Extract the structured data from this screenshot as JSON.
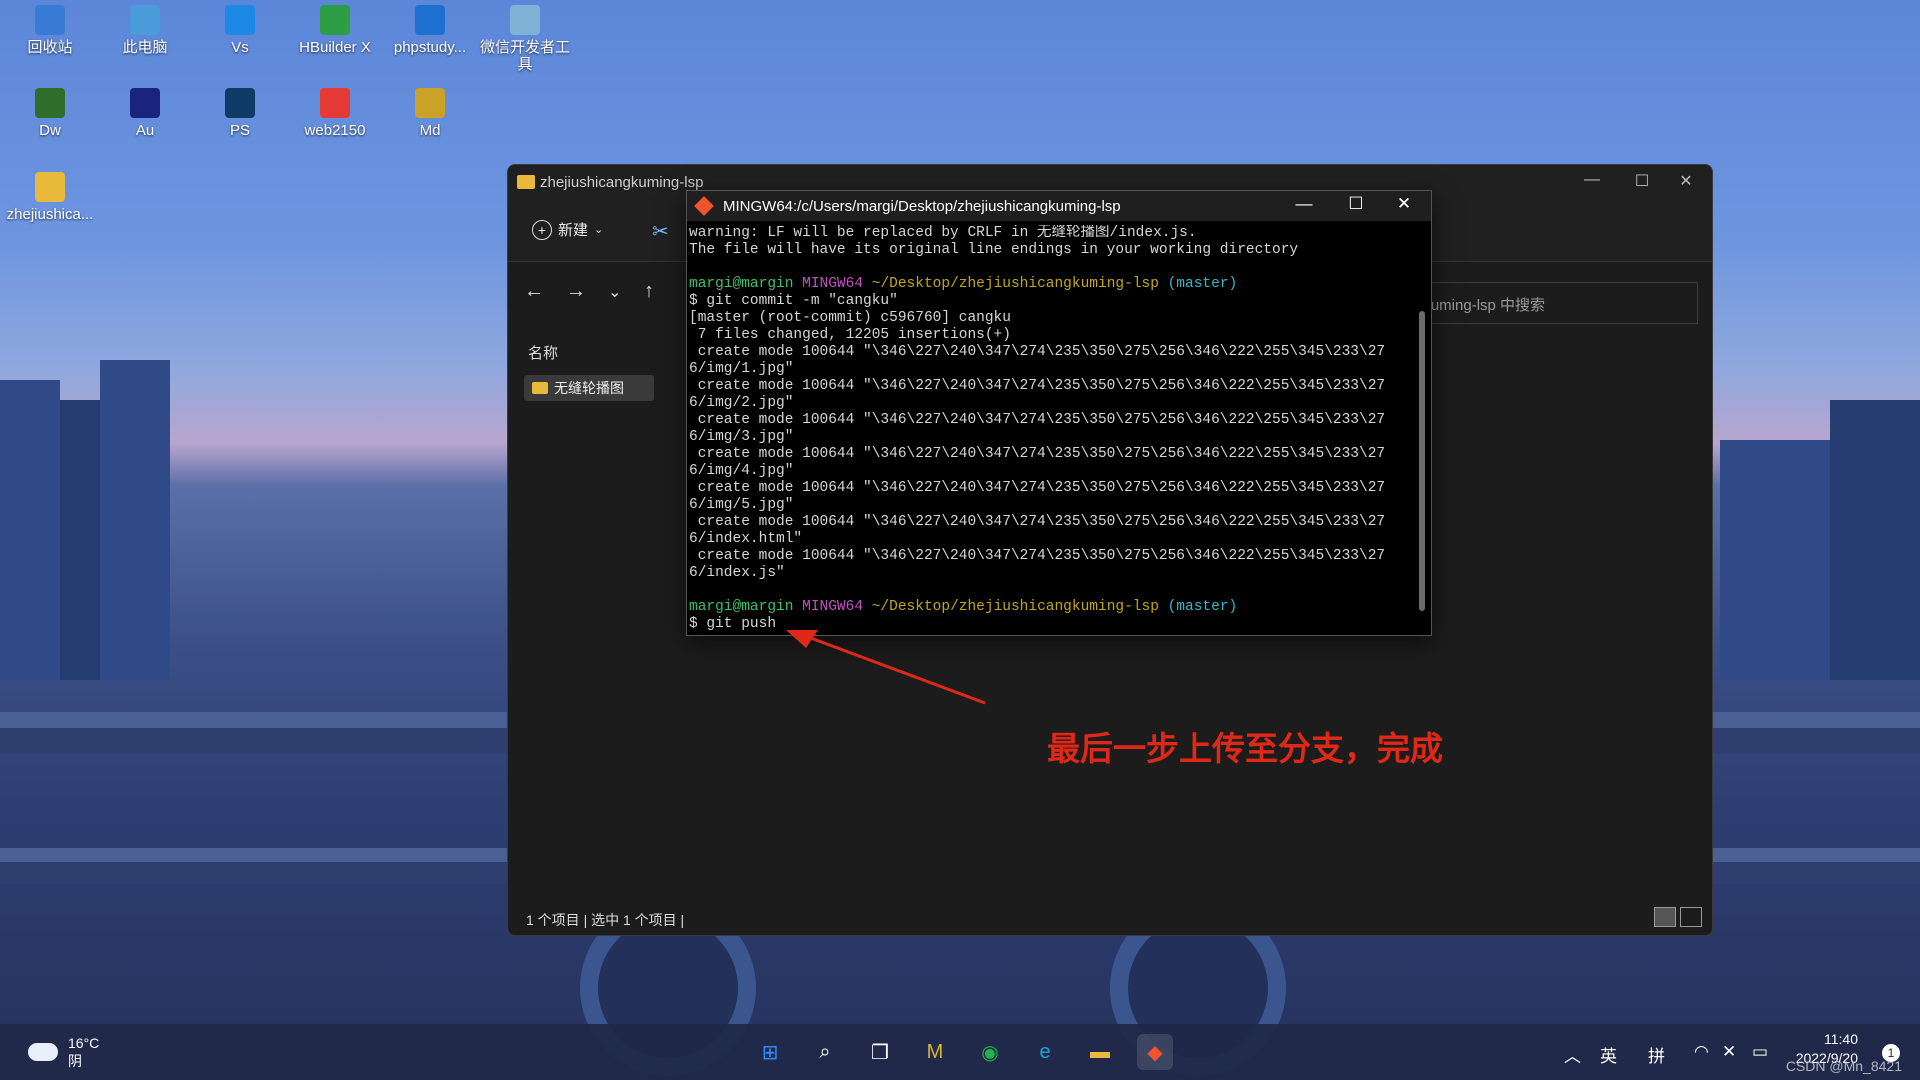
{
  "desktop": {
    "icons": [
      {
        "label": "回收站",
        "icon": "recycle-bin-icon",
        "color": "#3a7bd5"
      },
      {
        "label": "此电脑",
        "icon": "computer-icon",
        "color": "#4a9bd9"
      },
      {
        "label": "Vs",
        "icon": "vscode-icon",
        "color": "#1e88e5"
      },
      {
        "label": "HBuilder X",
        "icon": "hbuilder-icon",
        "color": "#2e9e44"
      },
      {
        "label": "phpstudy...",
        "icon": "phpstudy-icon",
        "color": "#1e70d0"
      },
      {
        "label": "微信开发者工具",
        "icon": "wechat-devtools-icon",
        "color": "#7fb2d6"
      },
      {
        "label": "Dw",
        "icon": "dreamweaver-icon",
        "color": "#2c6e2a"
      },
      {
        "label": "Au",
        "icon": "audition-icon",
        "color": "#1a237e"
      },
      {
        "label": "PS",
        "icon": "photoshop-icon",
        "color": "#0d3b66"
      },
      {
        "label": "web2150",
        "icon": "web2150-icon",
        "color": "#e53935"
      },
      {
        "label": "Md",
        "icon": "markdown-icon",
        "color": "#c9a227"
      },
      {
        "label": "zhejiushica...",
        "icon": "folder-icon",
        "color": "#e8b93a"
      }
    ]
  },
  "explorer": {
    "title": "zhejiushicangkuming-lsp",
    "new_label": "新建",
    "search_placeholder": "gkuming-lsp 中搜索",
    "column_name": "名称",
    "folder_item": "无缝轮播图",
    "status": "1 个项目  |  选中 1 个项目  |"
  },
  "terminal": {
    "title": "MINGW64:/c/Users/margi/Desktop/zhejiushicangkuming-lsp",
    "lines": [
      "warning: LF will be replaced by CRLF in 无缝轮播图/index.js.",
      "The file will have its original line endings in your working directory",
      "",
      "__PROMPT__",
      "$ git commit -m \"cangku\"",
      "[master (root-commit) c596760] cangku",
      " 7 files changed, 12205 insertions(+)",
      " create mode 100644 \"\\346\\227\\240\\347\\274\\235\\350\\275\\256\\346\\222\\255\\345\\233\\27",
      "6/img/1.jpg\"",
      " create mode 100644 \"\\346\\227\\240\\347\\274\\235\\350\\275\\256\\346\\222\\255\\345\\233\\27",
      "6/img/2.jpg\"",
      " create mode 100644 \"\\346\\227\\240\\347\\274\\235\\350\\275\\256\\346\\222\\255\\345\\233\\27",
      "6/img/3.jpg\"",
      " create mode 100644 \"\\346\\227\\240\\347\\274\\235\\350\\275\\256\\346\\222\\255\\345\\233\\27",
      "6/img/4.jpg\"",
      " create mode 100644 \"\\346\\227\\240\\347\\274\\235\\350\\275\\256\\346\\222\\255\\345\\233\\27",
      "6/img/5.jpg\"",
      " create mode 100644 \"\\346\\227\\240\\347\\274\\235\\350\\275\\256\\346\\222\\255\\345\\233\\27",
      "6/index.html\"",
      " create mode 100644 \"\\346\\227\\240\\347\\274\\235\\350\\275\\256\\346\\222\\255\\345\\233\\27",
      "6/index.js\"",
      "",
      "__PROMPT__",
      "$ git push"
    ],
    "prompt": {
      "user": "margi@margin",
      "env": "MINGW64",
      "path": "~/Desktop/zhejiushicangkuming-lsp",
      "branch": "(master)"
    }
  },
  "annotation": "最后一步上传至分支，完成",
  "taskbar": {
    "temp": "16°C",
    "weather": "阴",
    "apps": [
      "start-icon",
      "search-icon",
      "task-view-icon",
      "notes-app-icon",
      "wechat-icon",
      "edge-icon",
      "file-explorer-icon",
      "git-bash-icon"
    ],
    "ime1": "英",
    "ime2": "拼",
    "time": "11:40",
    "date": "2022/9/20",
    "notif": "1",
    "watermark": "CSDN @Mn_8421"
  },
  "colors": {
    "annotation": "#e02818",
    "prompt_user": "#3cc06a",
    "prompt_env": "#c050c0",
    "prompt_path": "#c2a61c",
    "prompt_branch": "#38b6c8"
  }
}
